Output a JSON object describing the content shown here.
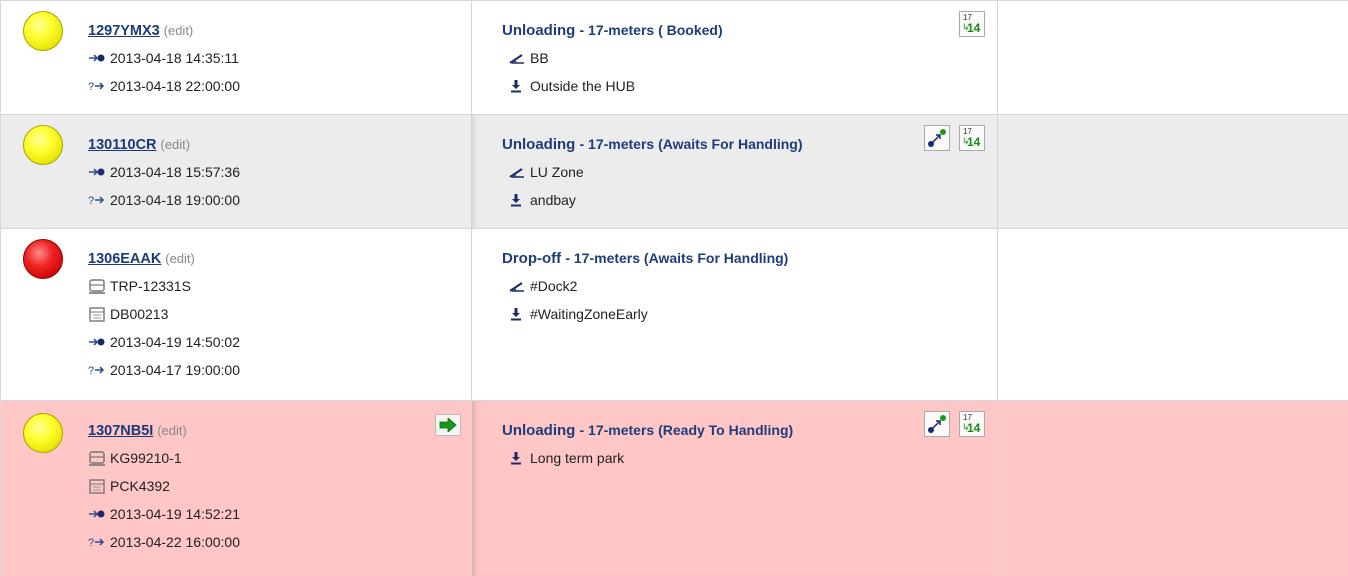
{
  "rows": [
    {
      "status": "yellow",
      "code": "1297YMX3",
      "edit": "(edit)",
      "truck": null,
      "trailer": null,
      "arrival": "2013-04-18 14:35:11",
      "eta": "2013-04-18 22:00:00",
      "task_type": "Unloading",
      "task_detail": "- 17-meters ( Booked)",
      "dock": "BB",
      "park": "Outside the HUB",
      "cal_top": "17",
      "cal_bottom": "14"
    },
    {
      "status": "yellow",
      "code": "130110CR",
      "edit": "(edit)",
      "truck": null,
      "trailer": null,
      "arrival": "2013-04-18 15:57:36",
      "eta": "2013-04-18 19:00:00",
      "task_type": "Unloading",
      "task_detail": "- 17-meters (Awaits For Handling)",
      "dock": "LU Zone",
      "park": "andbay",
      "cal_top": "17",
      "cal_bottom": "14"
    },
    {
      "status": "red",
      "code": "1306EAAK",
      "edit": "(edit)",
      "truck": "TRP-12331S",
      "trailer": "DB00213",
      "arrival": "2013-04-19 14:50:02",
      "eta": "2013-04-17 19:00:00",
      "task_type": "Drop-off",
      "task_detail": "- 17-meters (Awaits For Handling)",
      "dock": "#Dock2",
      "park": "#WaitingZoneEarly"
    },
    {
      "status": "yellow",
      "code": "1307NB5I",
      "edit": "(edit)",
      "truck": "KG99210-1",
      "trailer": "PCK4392",
      "arrival": "2013-04-19 14:52:21",
      "eta": "2013-04-22 16:00:00",
      "task_type": "Unloading",
      "task_detail": "- 17-meters (Ready To Handling)",
      "dock": null,
      "park": "Long term park",
      "cal_top": "17",
      "cal_bottom": "14"
    }
  ],
  "colors": {
    "row_gray": "#ececec",
    "row_alert": "#ffc6c6",
    "link": "#1a3a7a",
    "title": "#1f3c7a"
  }
}
